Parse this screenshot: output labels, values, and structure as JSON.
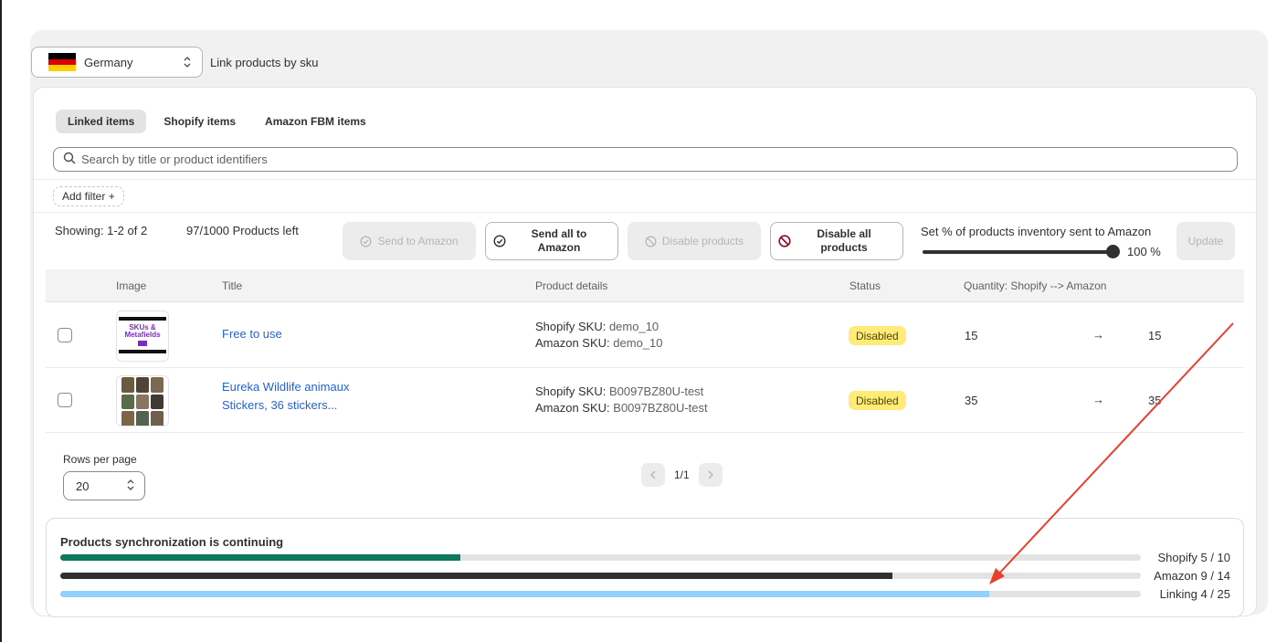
{
  "topbar": {
    "country": "Germany",
    "link_text": "Link products by sku",
    "flag_colors": [
      "#000000",
      "#dd0000",
      "#ffce00"
    ]
  },
  "tabs": [
    {
      "label": "Linked items",
      "active": true
    },
    {
      "label": "Shopify items",
      "active": false
    },
    {
      "label": "Amazon FBM items",
      "active": false
    }
  ],
  "search": {
    "placeholder": "Search by title or product identifiers"
  },
  "filter": {
    "label": "Add filter +"
  },
  "toolbar": {
    "showing": "Showing: 1-2 of 2",
    "products_left": "97/1000 Products left",
    "send_label": "Send to Amazon",
    "send_all_label": "Send all to Amazon",
    "disable_label": "Disable products",
    "disable_all_label": "Disable all products",
    "percent_title": "Set % of products inventory sent to Amazon",
    "percent_value": "100 %",
    "percent": 100,
    "update_label": "Update"
  },
  "table": {
    "headers": [
      "Image",
      "Title",
      "Product details",
      "Status",
      "Quantity: Shopify --> Amazon"
    ],
    "rows": [
      {
        "thumb_text": "SKUs & Metafields",
        "title_line1": "Free to use",
        "title_line2": "",
        "shopify_sku_label": "Shopify SKU:",
        "shopify_sku": "demo_10",
        "amazon_sku_label": "Amazon SKU:",
        "amazon_sku": "demo_10",
        "status": "Disabled",
        "qty_shopify": "15",
        "qty_arrow": "→",
        "qty_amazon": "15"
      },
      {
        "thumb_text": "",
        "title_line1": "Eureka Wildlife animaux",
        "title_line2": "Stickers, 36 stickers...",
        "shopify_sku_label": "Shopify SKU:",
        "shopify_sku": "B0097BZ80U-test",
        "amazon_sku_label": "Amazon SKU:",
        "amazon_sku": "B0097BZ80U-test",
        "status": "Disabled",
        "qty_shopify": "35",
        "qty_arrow": "→",
        "qty_amazon": "35"
      }
    ]
  },
  "pagination": {
    "rows_per_page_label": "Rows per page",
    "rows_per_page": "20",
    "page_text": "1/1"
  },
  "sync": {
    "title": "Products synchronization is continuing",
    "bars": [
      {
        "label": "Shopify 5 / 10",
        "fraction": 0.37,
        "color": "#0d7a5f"
      },
      {
        "label": "Amazon 9 / 14",
        "fraction": 0.77,
        "color": "#303030"
      },
      {
        "label": "Linking 4 / 25",
        "fraction": 0.86,
        "color": "#91d0ff"
      }
    ]
  },
  "annotation_color": "#e8412b",
  "colors": {
    "link": "#2463d1",
    "badge": "#ffeb78",
    "send_all": "#1a5e3a",
    "disable_all": "#8e0b21"
  }
}
